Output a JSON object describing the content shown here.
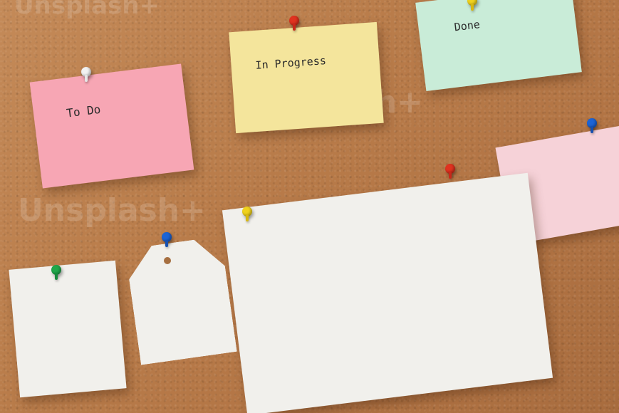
{
  "colors": {
    "cork": "#b97c4a",
    "note_pink": "#f7a6b4",
    "note_yellow": "#f4e59c",
    "note_green": "#c9ecd8",
    "note_light_pink": "#f6d2d8",
    "note_white": "#f1f0ec",
    "pin_white": "#f2f2f2",
    "pin_red": "#e0321f",
    "pin_yellow": "#f0d21e",
    "pin_blue": "#1c64d6",
    "pin_green": "#1fa84a"
  },
  "notes": {
    "todo": {
      "label": "To Do"
    },
    "in_progress": {
      "label": "In Progress"
    },
    "done": {
      "label": "Done"
    }
  },
  "watermark": {
    "text": "Unsplash+"
  }
}
